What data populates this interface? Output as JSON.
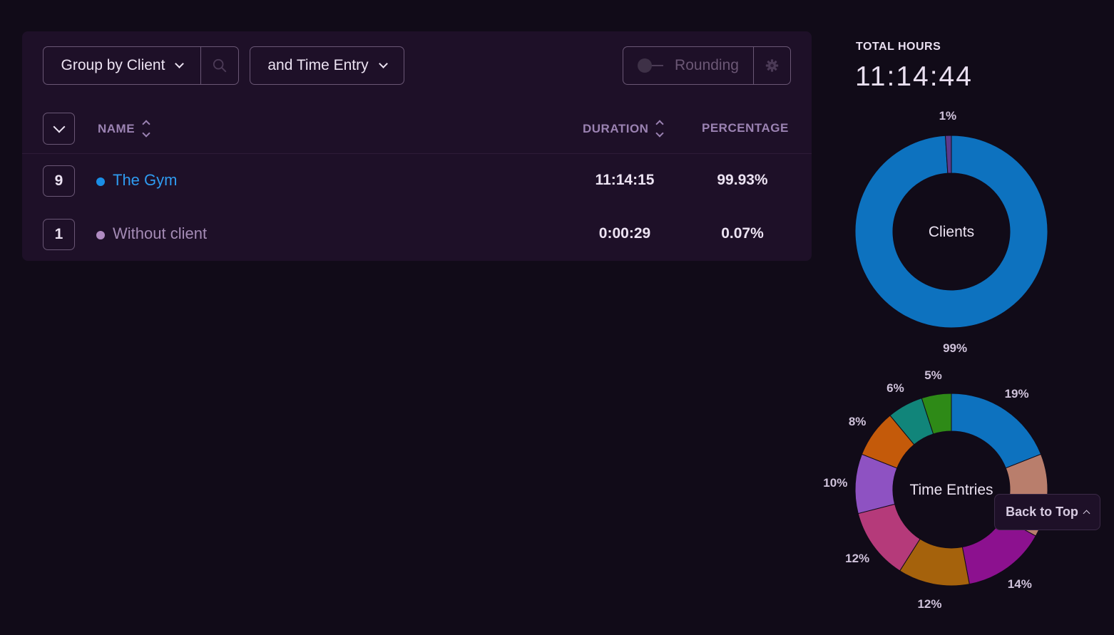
{
  "toolbar": {
    "group_by_label": "Group by Client",
    "subgroup_label": "and Time Entry",
    "rounding_label": "Rounding",
    "rounding_enabled": false
  },
  "table": {
    "columns": {
      "name": "NAME",
      "duration": "DURATION",
      "percentage": "PERCENTAGE"
    },
    "rows": [
      {
        "count": "9",
        "name": "The Gym",
        "duration": "11:14:15",
        "percentage": "99.93%",
        "color": "#1a8ee6"
      },
      {
        "count": "1",
        "name": "Without client",
        "duration": "0:00:29",
        "percentage": "0.07%",
        "color": "#b08bc2"
      }
    ]
  },
  "totals": {
    "label": "TOTAL HOURS",
    "value": "11:14:44"
  },
  "chart_data": [
    {
      "type": "pie",
      "title": "Clients",
      "categories": [
        "The Gym",
        "Without client"
      ],
      "values": [
        99,
        1
      ],
      "value_labels": [
        "99%",
        "1%"
      ],
      "colors": [
        "#0d72bf",
        "#5b3a8c"
      ]
    },
    {
      "type": "pie",
      "title": "Time Entries",
      "values": [
        19,
        14,
        14,
        12,
        12,
        10,
        8,
        6,
        5
      ],
      "value_labels": [
        "19%",
        "",
        "14%",
        "12%",
        "12%",
        "10%",
        "8%",
        "6%",
        "5%"
      ],
      "colors": [
        "#0d72bf",
        "#b97e6c",
        "#8c118f",
        "#a5620c",
        "#b53a7a",
        "#8e52c2",
        "#c45a0a",
        "#11857a",
        "#2e8a17"
      ]
    }
  ],
  "back_to_top": {
    "label": "Back to Top"
  }
}
